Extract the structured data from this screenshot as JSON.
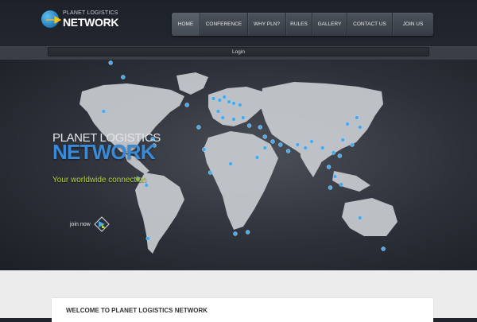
{
  "logo": {
    "line1": "PLANET LOGISTICS",
    "line2": "NETWORK"
  },
  "nav": [
    {
      "label": "HOME",
      "active": true
    },
    {
      "label": "CONFERENCE",
      "active": false
    },
    {
      "label": "WHY PLN?",
      "active": false
    },
    {
      "label": "RULES",
      "active": false
    },
    {
      "label": "GALLERY",
      "active": false
    },
    {
      "label": "CONTACT US",
      "active": false
    },
    {
      "label": "JOIN US",
      "active": false
    }
  ],
  "login": {
    "label": "Login"
  },
  "hero": {
    "title_top": "PLANET LOGISTICS",
    "title_main": "NETWORK",
    "tagline": "Your worldwide connection",
    "join_label": "join now"
  },
  "welcome": {
    "title": "WELCOME TO PLANET LOGISTICS NETWORK"
  },
  "colors": {
    "accent_blue": "#3a8ad8",
    "tagline_green": "#b6d43a",
    "pin_blue": "#4aa8e8"
  }
}
